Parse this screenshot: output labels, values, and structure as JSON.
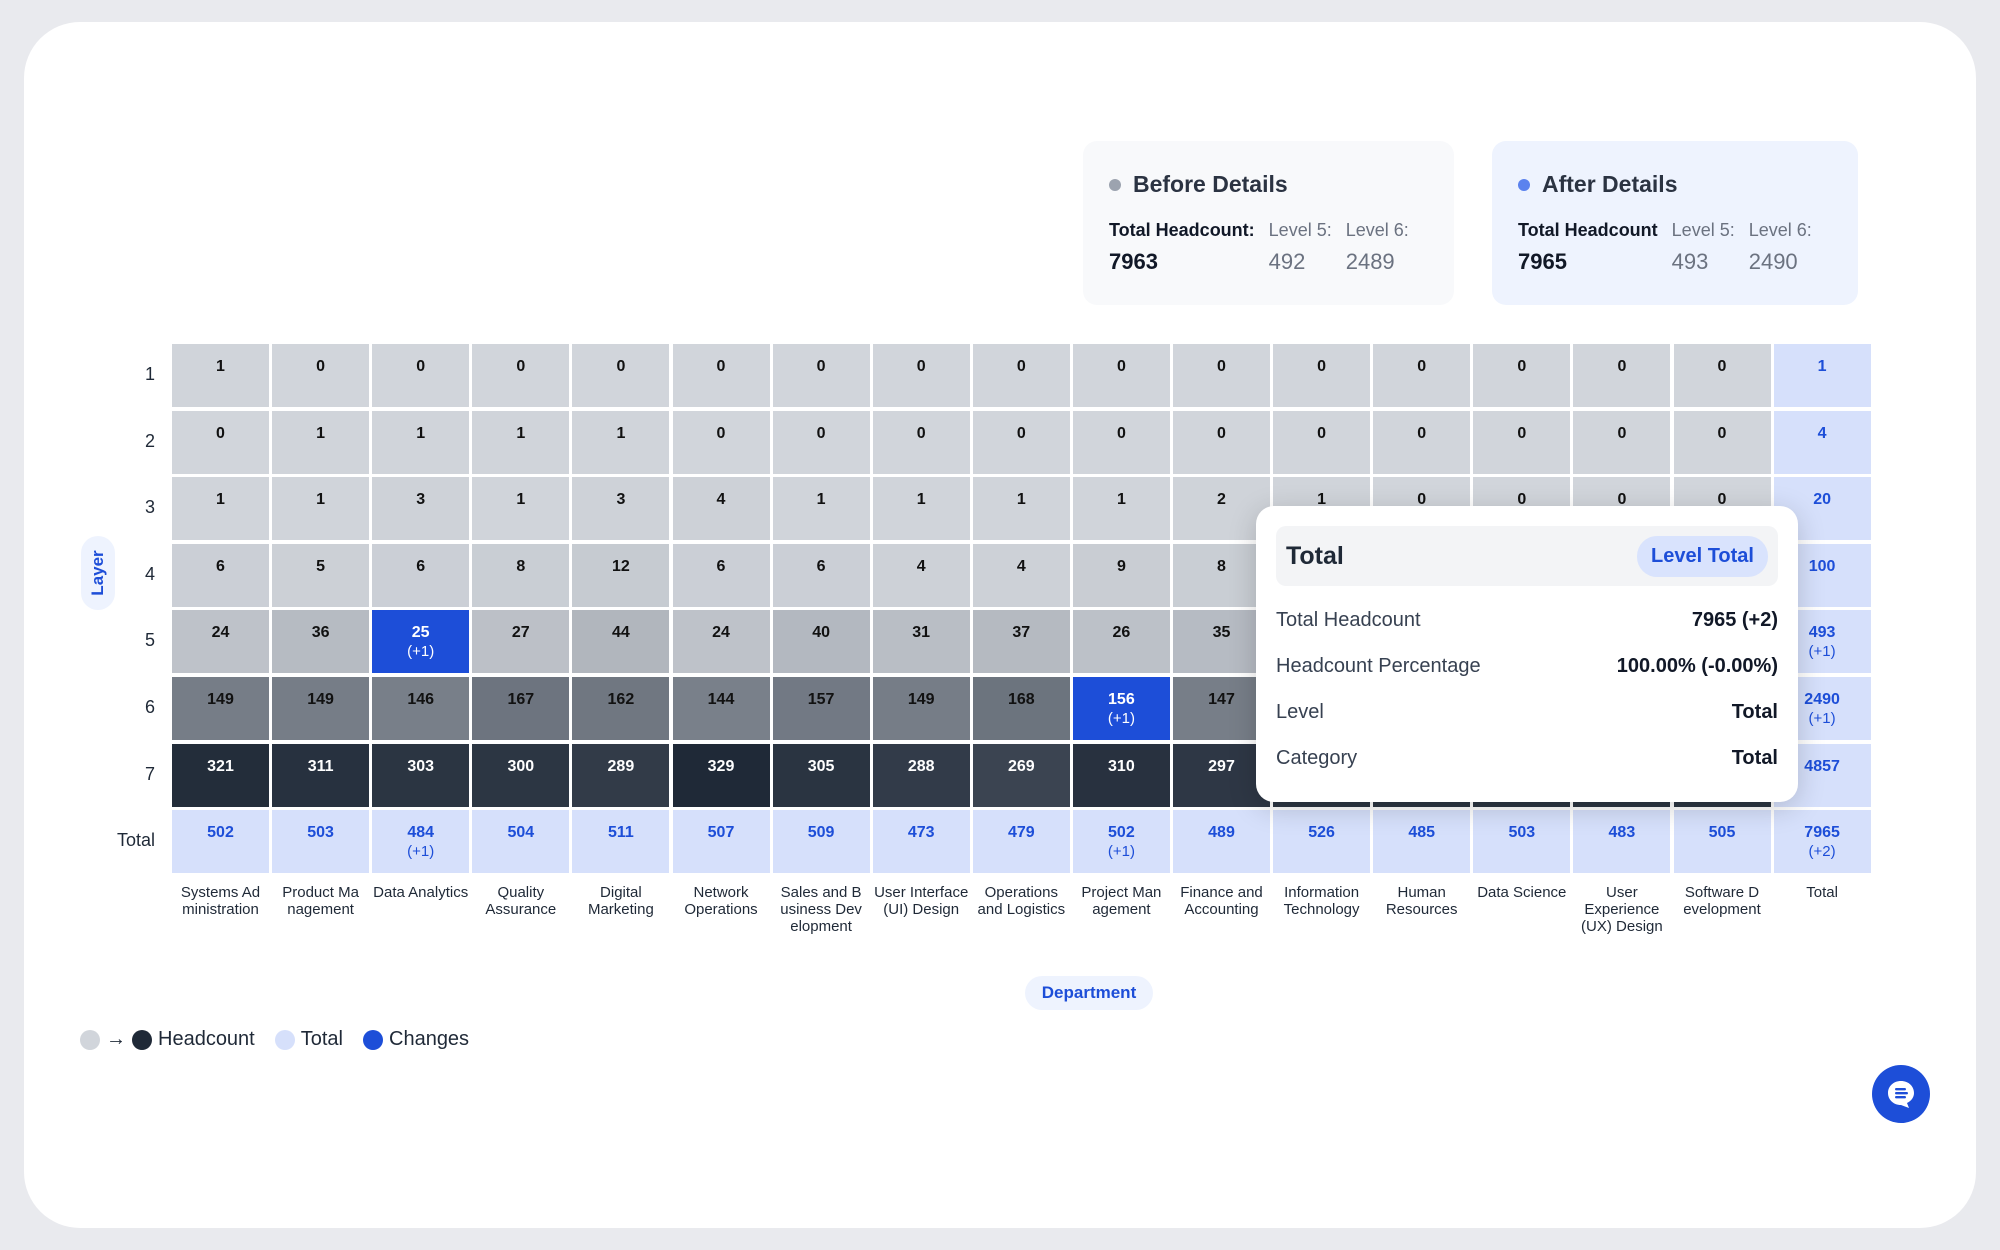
{
  "before_card": {
    "title": "Before Details",
    "dot_color": "#9ca3af",
    "total_label": "Total Headcount:",
    "total_value": "7963",
    "level5_label": "Level 5:",
    "level5_value": "492",
    "level6_label": "Level 6:",
    "level6_value": "2489"
  },
  "after_card": {
    "title": "After Details",
    "dot_color": "#5b82ee",
    "total_label": "Total Headcount",
    "total_value": "7965",
    "level5_label": "Level 5:",
    "level5_value": "493",
    "level6_label": "Level 6:",
    "level6_value": "2490"
  },
  "colors": {
    "scale_min": "#d1d5db",
    "scale_max": "#1f2937",
    "total": "#d6e0fb",
    "total_text": "#1d4ed8",
    "change": "#1d4ed8"
  },
  "chart_data": {
    "type": "heatmap",
    "title": "",
    "xlabel": "Department",
    "ylabel": "Layer",
    "x_categories": [
      "Systems Ad ministration",
      "Product Ma nagement",
      "Data Analytics",
      "Quality Assurance",
      "Digital Marketing",
      "Network Operations",
      "Sales and B usiness Dev elopment",
      "User Interface (UI) Design",
      "Operations and Logistics",
      "Project Man agement",
      "Finance and Accounting",
      "Information Technology",
      "Human Resources",
      "Data Science",
      "User Experience (UX) Design",
      "Software D evelopment",
      "Total"
    ],
    "y_categories": [
      "1",
      "2",
      "3",
      "4",
      "5",
      "6",
      "7",
      "Total"
    ],
    "values": [
      [
        1,
        0,
        0,
        0,
        0,
        0,
        0,
        0,
        0,
        0,
        0,
        0,
        0,
        0,
        0,
        0,
        1
      ],
      [
        0,
        1,
        1,
        1,
        1,
        0,
        0,
        0,
        0,
        0,
        0,
        0,
        0,
        0,
        0,
        0,
        4
      ],
      [
        1,
        1,
        3,
        1,
        3,
        4,
        1,
        1,
        1,
        1,
        2,
        1,
        0,
        0,
        0,
        0,
        20
      ],
      [
        6,
        5,
        6,
        8,
        12,
        6,
        6,
        4,
        4,
        9,
        8,
        null,
        null,
        null,
        null,
        null,
        100
      ],
      [
        24,
        36,
        25,
        27,
        44,
        24,
        40,
        31,
        37,
        26,
        35,
        null,
        null,
        null,
        null,
        null,
        493
      ],
      [
        149,
        149,
        146,
        167,
        162,
        144,
        157,
        149,
        168,
        156,
        147,
        null,
        null,
        null,
        null,
        null,
        2490
      ],
      [
        321,
        311,
        303,
        300,
        289,
        329,
        305,
        288,
        269,
        310,
        297,
        null,
        null,
        null,
        null,
        null,
        4857
      ],
      [
        502,
        503,
        484,
        504,
        511,
        507,
        509,
        473,
        479,
        502,
        489,
        526,
        485,
        503,
        483,
        505,
        7965
      ]
    ],
    "changes": [
      {
        "row": 4,
        "col": 2,
        "delta": "(+1)"
      },
      {
        "row": 5,
        "col": 9,
        "delta": "(+1)"
      },
      {
        "row": 7,
        "col": 2,
        "delta": "(+1)"
      },
      {
        "row": 7,
        "col": 9,
        "delta": "(+1)"
      },
      {
        "row": 4,
        "col": 16,
        "delta": "(+1)"
      },
      {
        "row": 5,
        "col": 16,
        "delta": "(+1)"
      },
      {
        "row": 7,
        "col": 16,
        "delta": "(+2)"
      }
    ],
    "highlighted_cells": [
      {
        "row": 4,
        "col": 2
      },
      {
        "row": 5,
        "col": 9
      }
    ],
    "value_range": [
      0,
      329
    ],
    "legend": {
      "placement": "bottom-left",
      "items": [
        "Headcount",
        "Total",
        "Changes"
      ]
    }
  },
  "tooltip": {
    "title": "Total",
    "badge": "Level Total",
    "rows": [
      {
        "label": "Total Headcount",
        "value": "7965 (+2)"
      },
      {
        "label": "Headcount Percentage",
        "value": "100.00% (-0.00%)"
      },
      {
        "label": "Level",
        "value": "Total"
      },
      {
        "label": "Category",
        "value": "Total"
      }
    ]
  },
  "legend": {
    "arrow": "→",
    "headcount_label": "Headcount",
    "total_label": "Total",
    "changes_label": "Changes"
  },
  "chat_button": {
    "icon": "chat-bubble-icon"
  }
}
